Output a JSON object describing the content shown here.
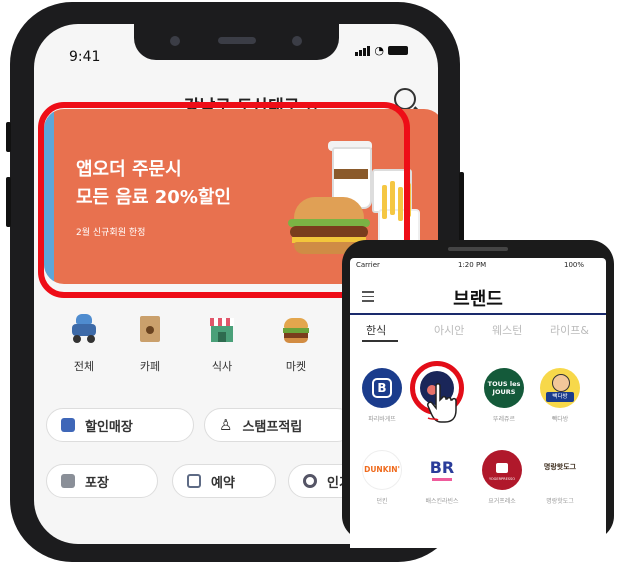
{
  "main_app": {
    "status_time": "9:41",
    "location": "강남구 도산대로",
    "banner": {
      "line1": "앱오더 주문시",
      "line2": "모든 음료 20%할인",
      "sub": "2월 신규회원 한정"
    },
    "categories": [
      {
        "label": "전체",
        "icon": "scooter-icon"
      },
      {
        "label": "카페",
        "icon": "coffee-bag-icon"
      },
      {
        "label": "식사",
        "icon": "store-icon"
      },
      {
        "label": "마켓",
        "icon": "burger-icon"
      }
    ],
    "pills": [
      {
        "label": "할인매장",
        "icon": "discount-icon"
      },
      {
        "label": "스탬프적립",
        "icon": "stamp-icon"
      },
      {
        "label": "포장",
        "icon": "takeout-icon"
      },
      {
        "label": "예약",
        "icon": "calendar-icon"
      },
      {
        "label": "인기",
        "icon": "popular-icon"
      }
    ]
  },
  "brand_app": {
    "status_carrier": "Carrier",
    "status_time": "1:20 PM",
    "status_battery": "100%",
    "title": "브랜드",
    "tabs": [
      "한식",
      "아시안",
      "웨스턴",
      "라이프&"
    ],
    "brands": [
      {
        "label": "파리바게뜨",
        "logo_text": "B",
        "color": "#1b3c8c"
      },
      {
        "label": "",
        "logo_text": "",
        "color": "#1a2659"
      },
      {
        "label": "뚜레쥬르",
        "logo_text": "TOUS les JOURS",
        "color": "#145a3a"
      },
      {
        "label": "빽다방",
        "logo_text": "빽다방",
        "color": "#f7d84a"
      },
      {
        "label": "던킨",
        "logo_text": "DUNKIN'",
        "color": "#ffffff"
      },
      {
        "label": "배스킨라빈스",
        "logo_text": "BR",
        "color": "#ffffff"
      },
      {
        "label": "요거프레소",
        "logo_text": "YOGERPRESSO",
        "color": "#b0182b"
      },
      {
        "label": "명랑핫도그",
        "logo_text": "명랑핫도그",
        "color": "#ffffff"
      }
    ]
  },
  "colors": {
    "banner": "#e8714f",
    "highlight": "#ee0d17",
    "brand_rule": "#1a2a6c"
  }
}
